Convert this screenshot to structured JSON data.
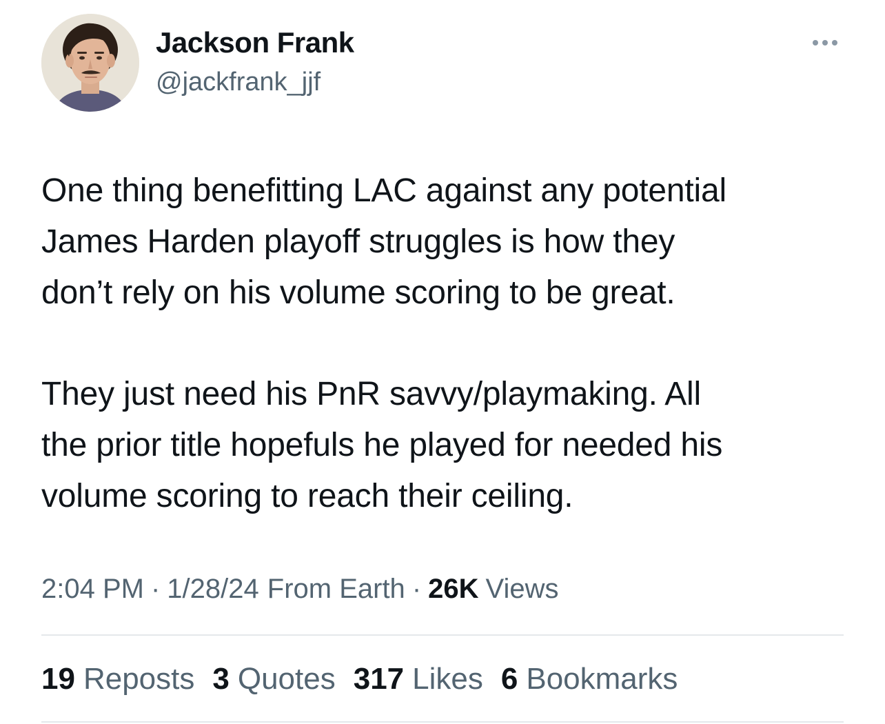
{
  "author": {
    "display_name": "Jackson Frank",
    "handle": "@jackfrank_jjf"
  },
  "more_icon": "ellipsis-icon",
  "tweet": {
    "paragraph1": [
      "One thing benefitting LAC against any potential",
      "James Harden playoff struggles is how they",
      "don’t rely on his volume scoring to be great."
    ],
    "paragraph2": [
      "They just need his PnR savvy/playmaking. All",
      "the prior title hopefuls he played for needed his",
      "volume scoring to reach their ceiling."
    ]
  },
  "meta": {
    "time": "2:04 PM",
    "separator": "·",
    "date": "1/28/24",
    "source": "From Earth",
    "views_count": "26K",
    "views_label": "Views"
  },
  "stats": {
    "reposts_count": "19",
    "reposts_label": "Reposts",
    "quotes_count": "3",
    "quotes_label": "Quotes",
    "likes_count": "317",
    "likes_label": "Likes",
    "bookmarks_count": "6",
    "bookmarks_label": "Bookmarks"
  },
  "colors": {
    "text_primary": "#0f1419",
    "text_secondary": "#536471",
    "divider": "#e4e8eb"
  }
}
